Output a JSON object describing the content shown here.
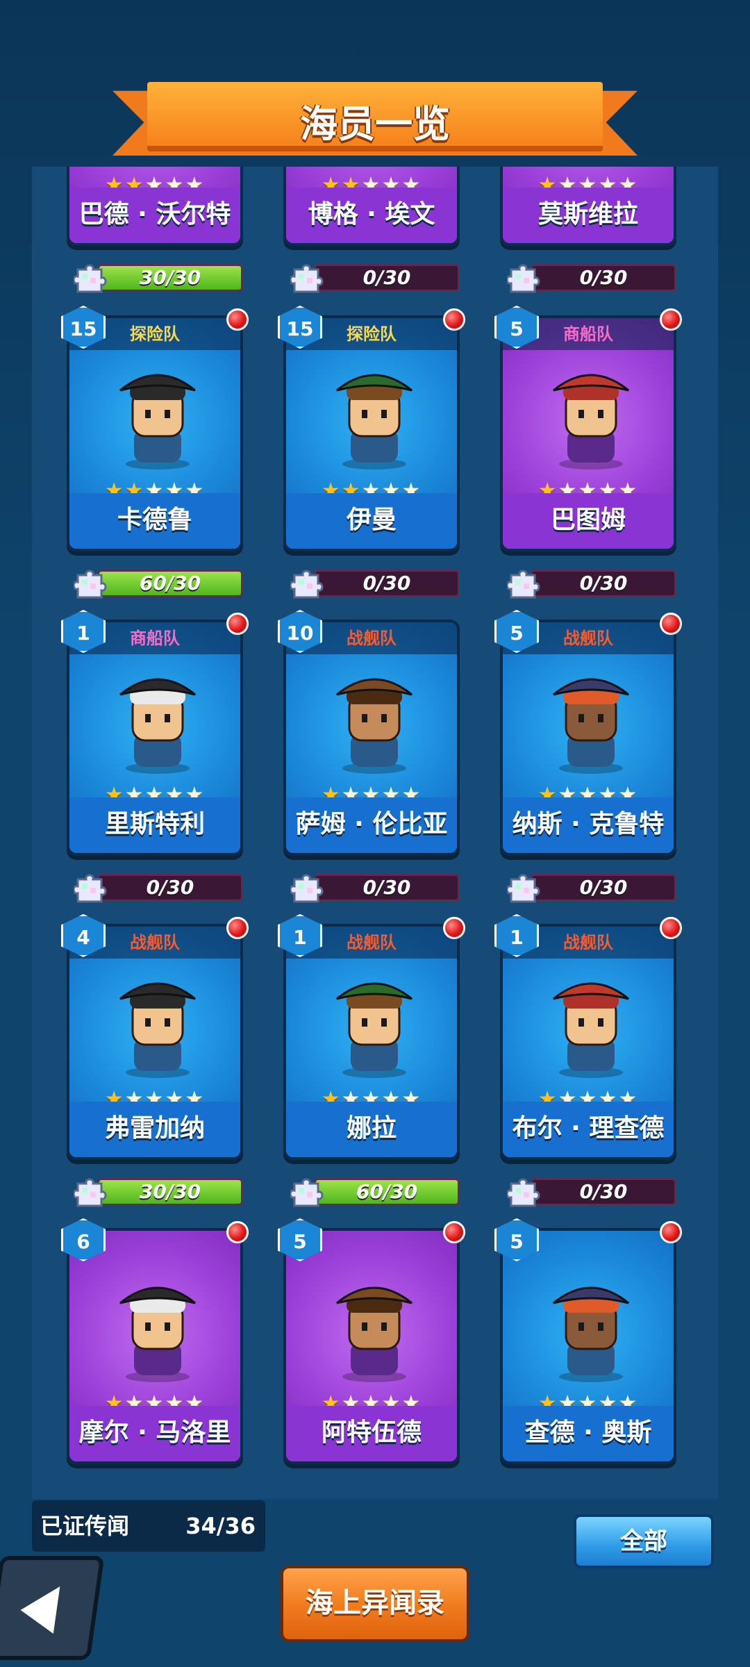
{
  "header": {
    "title": "海员一览"
  },
  "cards": [
    {
      "name": "巴德 · 沃尔特",
      "level": "",
      "team": "",
      "stars": 2,
      "progress": "30/30",
      "fill": 1.0,
      "color": "purple",
      "dot": false
    },
    {
      "name": "博格 · 埃文",
      "level": "",
      "team": "",
      "stars": 2,
      "progress": "0/30",
      "fill": 0.0,
      "color": "purple",
      "dot": false
    },
    {
      "name": "莫斯维拉",
      "level": "",
      "team": "",
      "stars": 1,
      "progress": "0/30",
      "fill": 0.0,
      "color": "purple",
      "dot": false
    },
    {
      "name": "卡德鲁",
      "level": "15",
      "team": "探险队",
      "stars": 2,
      "progress": "60/30",
      "fill": 1.0,
      "color": "blue",
      "dot": true,
      "teamtype": "exp"
    },
    {
      "name": "伊曼",
      "level": "15",
      "team": "探险队",
      "stars": 2,
      "progress": "0/30",
      "fill": 0.0,
      "color": "blue",
      "dot": true,
      "teamtype": "exp"
    },
    {
      "name": "巴图姆",
      "level": "5",
      "team": "商船队",
      "stars": 1,
      "progress": "0/30",
      "fill": 0.0,
      "color": "purple",
      "dot": true,
      "teamtype": "merch"
    },
    {
      "name": "里斯特利",
      "level": "1",
      "team": "商船队",
      "stars": 1,
      "progress": "0/30",
      "fill": 0.0,
      "color": "blue",
      "dot": true,
      "teamtype": "merch"
    },
    {
      "name": "萨姆 · 伦比亚",
      "level": "10",
      "team": "战舰队",
      "stars": 1,
      "progress": "0/30",
      "fill": 0.0,
      "color": "blue",
      "dot": false,
      "teamtype": "war"
    },
    {
      "name": "纳斯 · 克鲁特",
      "level": "5",
      "team": "战舰队",
      "stars": 1,
      "progress": "0/30",
      "fill": 0.0,
      "color": "blue",
      "dot": true,
      "teamtype": "war"
    },
    {
      "name": "弗雷加纳",
      "level": "4",
      "team": "战舰队",
      "stars": 1,
      "progress": "30/30",
      "fill": 1.0,
      "color": "blue",
      "dot": true,
      "teamtype": "war"
    },
    {
      "name": "娜拉",
      "level": "1",
      "team": "战舰队",
      "stars": 1,
      "progress": "60/30",
      "fill": 1.0,
      "color": "blue",
      "dot": true,
      "teamtype": "war"
    },
    {
      "name": "布尔 · 理查德",
      "level": "1",
      "team": "战舰队",
      "stars": 1,
      "progress": "0/30",
      "fill": 0.0,
      "color": "blue",
      "dot": true,
      "teamtype": "war"
    },
    {
      "name": "摩尔 · 马洛里",
      "level": "6",
      "team": "",
      "stars": 1,
      "progress": "",
      "fill": 0.0,
      "color": "purple",
      "dot": true
    },
    {
      "name": "阿特伍德",
      "level": "5",
      "team": "",
      "stars": 1,
      "progress": "",
      "fill": 0.0,
      "color": "purple",
      "dot": true
    },
    {
      "name": "查德 · 奥斯",
      "level": "5",
      "team": "",
      "stars": 1,
      "progress": "",
      "fill": 0.0,
      "color": "blue",
      "dot": true
    }
  ],
  "footer": {
    "counter_label": "已证传闻",
    "counter_value": "34/36",
    "all_button": "全部",
    "chronicle_button": "海上异闻录"
  },
  "icons": {
    "back": "back-arrow-icon",
    "puzzle": "puzzle-piece-icon",
    "notification": "red-dot-icon"
  },
  "colors": {
    "background": "#0f446c",
    "banner": "#f07a1c",
    "blue_card": "#1a86d8",
    "purple_card": "#9a3fd8",
    "progress_fill": "#4fb61e"
  }
}
